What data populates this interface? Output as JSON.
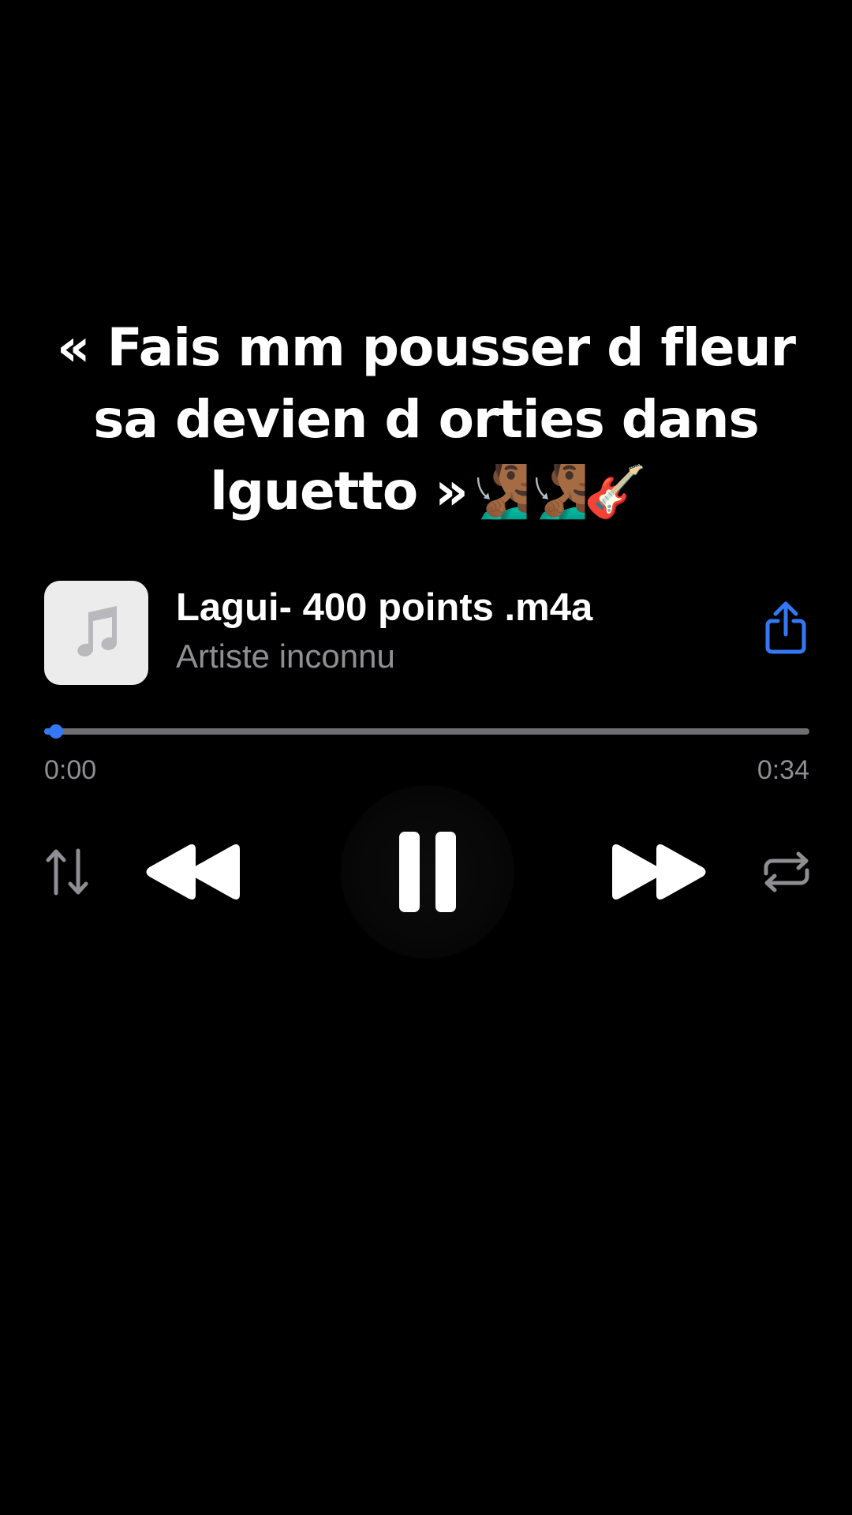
{
  "caption": {
    "lines": [
      "« Fais mm pousser d fleur",
      "sa devien d orties dans",
      "lguetto »"
    ],
    "emojis": "🧏🏾‍♂️🧏🏾‍♂️🎸"
  },
  "track": {
    "artwork_icon": "music-note-icon",
    "title": "Lagui- 400 points .m4a",
    "artist": "Artiste inconnu"
  },
  "playback": {
    "elapsed": "0:00",
    "total": "0:34",
    "progress_fraction": 0.015,
    "state": "playing"
  },
  "controls": {
    "shuffle_icon": "sort-arrows-icon",
    "rewind_icon": "rewind-icon",
    "play_pause_icon": "pause-icon",
    "forward_icon": "fast-forward-icon",
    "repeat_icon": "repeat-icon",
    "share_icon": "share-icon"
  },
  "colors": {
    "background": "#000000",
    "accent": "#3478f6",
    "secondary_text": "#8e8e93",
    "track_bar": "#6e6e73"
  }
}
